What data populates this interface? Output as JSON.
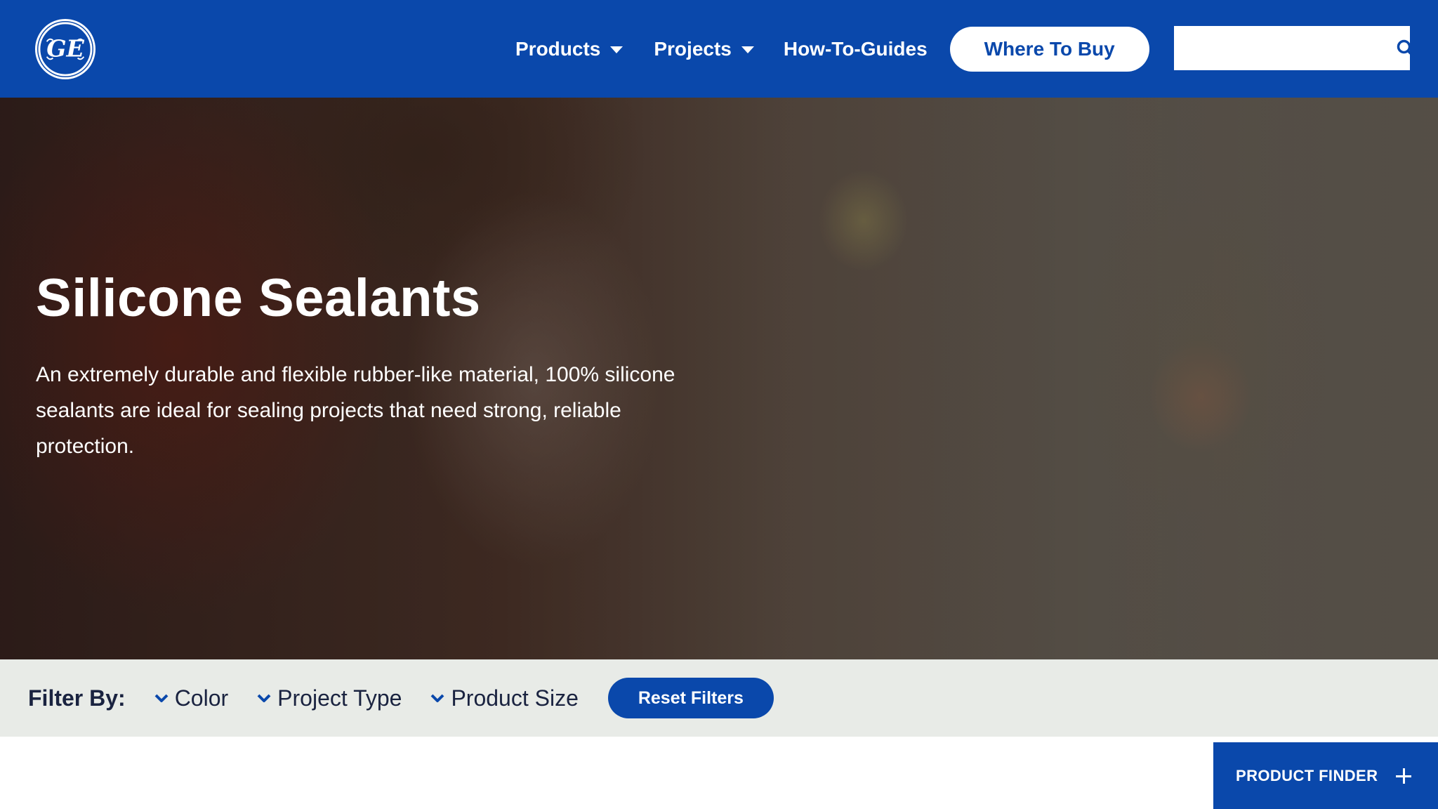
{
  "header": {
    "logo_alt": "GE",
    "nav": [
      {
        "label": "Products",
        "has_dropdown": true
      },
      {
        "label": "Projects",
        "has_dropdown": true
      },
      {
        "label": "How-To-Guides",
        "has_dropdown": false
      }
    ],
    "where_to_buy_label": "Where To Buy",
    "search": {
      "value": "",
      "placeholder": "",
      "icon": "search-icon"
    }
  },
  "hero": {
    "title": "Silicone Sealants",
    "description": "An extremely durable and flexible rubber-like material, 100% silicone sealants are ideal for sealing projects that need strong, reliable protection."
  },
  "filters": {
    "label": "Filter By:",
    "options": [
      {
        "label": "Color",
        "icon": "chevron-down-icon"
      },
      {
        "label": "Project Type",
        "icon": "chevron-down-icon"
      },
      {
        "label": "Product Size",
        "icon": "chevron-down-icon"
      }
    ],
    "reset_label": "Reset Filters"
  },
  "product_finder": {
    "label": "PRODUCT FINDER",
    "icon": "plus-icon"
  },
  "colors": {
    "brand_blue": "#0a48ab",
    "filter_bar_bg": "#e8ebe7",
    "text_dark": "#1a2340"
  }
}
